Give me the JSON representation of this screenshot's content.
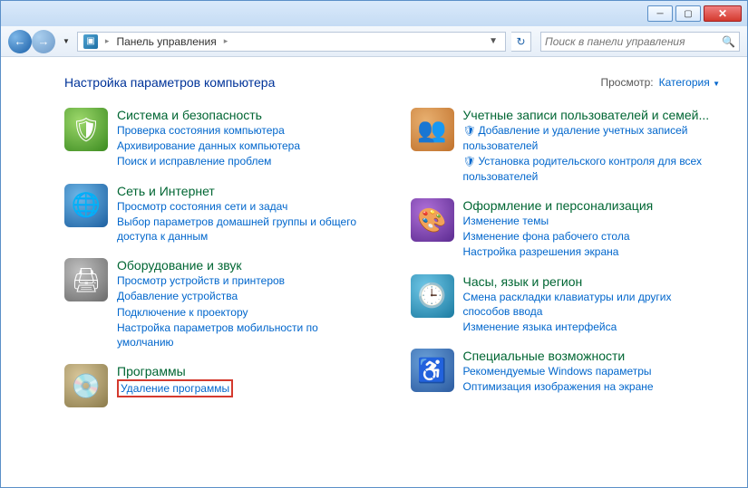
{
  "titlebar": {
    "min": "─",
    "max": "▢",
    "close": "✕"
  },
  "nav": {
    "back": "←",
    "forward": "→",
    "dropdown": "▼",
    "breadcrumb_icon": "▣",
    "breadcrumb_text": "Панель управления",
    "breadcrumb_sep": "▸",
    "refresh": "↻",
    "search_placeholder": "Поиск в панели управления",
    "search_icon": "🔍"
  },
  "header": {
    "title": "Настройка параметров компьютера",
    "view_label": "Просмотр:",
    "view_value": "Категория",
    "view_dd": "▼"
  },
  "categories": {
    "system": {
      "title": "Система и безопасность",
      "tasks": [
        "Проверка состояния компьютера",
        "Архивирование данных компьютера",
        "Поиск и исправление проблем"
      ]
    },
    "network": {
      "title": "Сеть и Интернет",
      "tasks": [
        "Просмотр состояния сети и задач",
        "Выбор параметров домашней группы и общего доступа к данным"
      ]
    },
    "hardware": {
      "title": "Оборудование и звук",
      "tasks": [
        "Просмотр устройств и принтеров",
        "Добавление устройства",
        "Подключение к проектору",
        "Настройка параметров мобильности по умолчанию"
      ]
    },
    "programs": {
      "title": "Программы",
      "tasks": [
        "Удаление программы"
      ]
    },
    "users": {
      "title": "Учетные записи пользователей и семей...",
      "tasks": [
        {
          "icon": "🛡",
          "text": "Добавление и удаление учетных записей пользователей"
        },
        {
          "icon": "🛡",
          "text": "Установка родительского контроля для всех пользователей"
        }
      ]
    },
    "appearance": {
      "title": "Оформление и персонализация",
      "tasks": [
        "Изменение темы",
        "Изменение фона рабочего стола",
        "Настройка разрешения экрана"
      ]
    },
    "clock": {
      "title": "Часы, язык и регион",
      "tasks": [
        "Смена раскладки клавиатуры или других способов ввода",
        "Изменение языка интерфейса"
      ]
    },
    "access": {
      "title": "Специальные возможности",
      "tasks": [
        "Рекомендуемые Windows параметры",
        "Оптимизация изображения на экране"
      ]
    }
  }
}
